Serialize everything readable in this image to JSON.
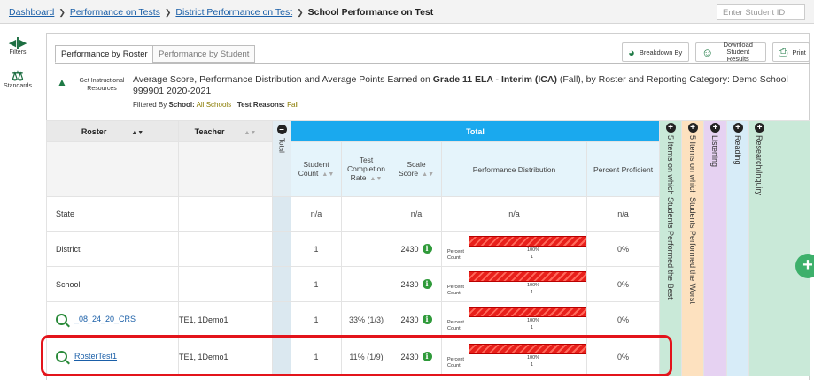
{
  "breadcrumb": {
    "items": [
      "Dashboard",
      "Performance on Tests",
      "District Performance on Test"
    ],
    "current": "School Performance on Test"
  },
  "search": {
    "placeholder": "Enter Student ID"
  },
  "leftbar": {
    "filters": "Filters",
    "standards": "Standards"
  },
  "tabs": {
    "roster": "Performance by Roster",
    "student": "Performance by Student"
  },
  "toolbar": {
    "breakdown": "Breakdown By",
    "download": "Download Student Results",
    "print": "Print"
  },
  "resources": {
    "label": "Get Instructional Resources"
  },
  "report": {
    "title_pre": "Average Score, Performance Distribution and Average Points Earned on ",
    "test_name": "Grade 11 ELA - Interim (ICA)",
    "title_post": " (Fall), by Roster and Reporting Category: Demo School 999901 2020-2021",
    "filter_prefix": "Filtered By ",
    "school_label": "School:",
    "school_value": "All Schools",
    "reasons_label": "Test Reasons:",
    "reasons_value": "Fall"
  },
  "table": {
    "h_roster": "Roster",
    "h_teacher": "Teacher",
    "h_total_col": "Total",
    "h_total": "Total",
    "h_student_count": "Student Count",
    "h_completion": "Test Completion Rate",
    "h_scale": "Scale Score",
    "h_distribution": "Performance Distribution",
    "h_proficient": "Percent Proficient",
    "side_cols": [
      "5 Items on which Students Performed the Best",
      "5 Items on which Students Performed the Worst",
      "Listening",
      "Reading",
      "Research/Inquiry"
    ],
    "dist_percent_label": "Percent",
    "dist_count_label": "Count",
    "rows": [
      {
        "roster": "State",
        "teacher": "",
        "count": "n/a",
        "completion": "",
        "scale": "n/a",
        "dist": "n/a",
        "proficient": "n/a"
      },
      {
        "roster": "District",
        "teacher": "",
        "count": "1",
        "completion": "",
        "scale": "2430",
        "dist_pct": "100%",
        "dist_count": "1",
        "proficient": "0%"
      },
      {
        "roster": "School",
        "teacher": "",
        "count": "1",
        "completion": "",
        "scale": "2430",
        "dist_pct": "100%",
        "dist_count": "1",
        "proficient": "0%"
      },
      {
        "roster": "_08_24_20_CRS",
        "teacher": "TE1, 1Demo1",
        "count": "1",
        "completion": "33% (1/3)",
        "scale": "2430",
        "dist_pct": "100%",
        "dist_count": "1",
        "proficient": "0%"
      },
      {
        "roster": "RosterTest1",
        "teacher": "TE1, 1Demo1",
        "count": "1",
        "completion": "11% (1/9)",
        "scale": "2430",
        "dist_pct": "100%",
        "dist_count": "1",
        "proficient": "0%"
      }
    ]
  },
  "colors": {
    "accent": "#1aa9ee",
    "green": "#2f9a3a",
    "highlight": "#e3141b"
  }
}
